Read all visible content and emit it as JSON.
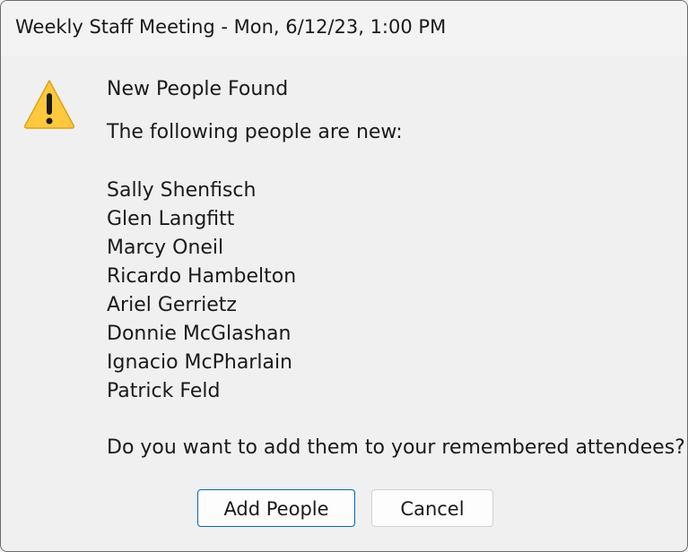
{
  "window": {
    "title": "Weekly Staff Meeting - Mon, 6/12/23, 1:00 PM"
  },
  "message": {
    "icon": "warning-icon",
    "heading": "New People Found",
    "intro": "The following people are new:",
    "people": [
      "Sally Shenfisch",
      "Glen Langfitt",
      "Marcy Oneil",
      "Ricardo Hambelton",
      "Ariel Gerrietz",
      "Donnie McGlashan",
      "Ignacio McPharlain",
      "Patrick Feld"
    ],
    "question": "Do you want to add them to your remembered attendees?"
  },
  "buttons": {
    "add_label": "Add People",
    "cancel_label": "Cancel"
  },
  "colors": {
    "accent": "#0067c0",
    "warning_fill": "#ffc83d",
    "background": "#f0f0f0"
  }
}
